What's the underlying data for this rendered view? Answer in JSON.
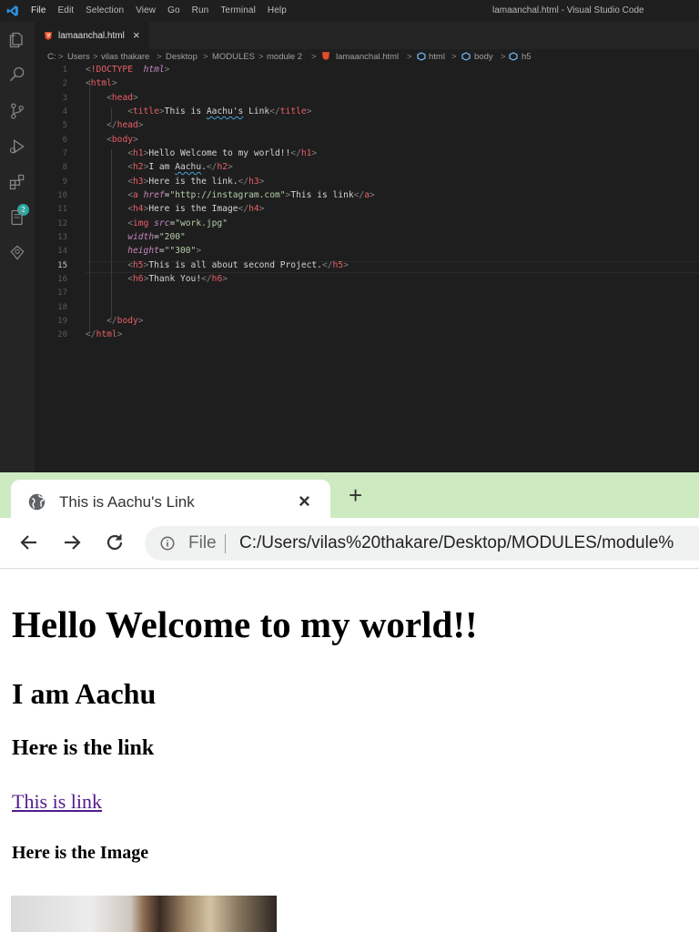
{
  "vscode": {
    "menus": [
      "File",
      "Edit",
      "Selection",
      "View",
      "Go",
      "Run",
      "Terminal",
      "Help"
    ],
    "window_title": "lamaanchal.html - Visual Studio Code",
    "tab": {
      "label": "lamaanchal.html",
      "close": "×"
    },
    "breadcrumbs": [
      "C:",
      "Users",
      "vilas thakare",
      "Desktop",
      "MODULES",
      "module 2",
      "lamaanchal.html",
      "html",
      "body",
      "h5"
    ],
    "breadcrumb_sep": ">",
    "badge": "2",
    "current_line": 15,
    "lines": [
      "1",
      "2",
      "3",
      "4",
      "5",
      "6",
      "7",
      "8",
      "9",
      "10",
      "11",
      "12",
      "13",
      "14",
      "15",
      "16",
      "17",
      "18",
      "19",
      "20"
    ]
  },
  "browser": {
    "tab_title": "This is Aachu's Link",
    "tab_close": "×",
    "new_tab": "+",
    "url_chip": "File",
    "url": "C:/Users/vilas%20thakare/Desktop/MODULES/module%",
    "page": {
      "h1": "Hello Welcome to my world!!",
      "h2": "I am Aachu",
      "h3": "Here is the link",
      "link": "This is link",
      "h4": "Here is the Image"
    }
  },
  "colors": {
    "vscode_bg": "#1e1e1e",
    "tabstrip": "#cdeac0",
    "link_visited": "#551a8b"
  }
}
